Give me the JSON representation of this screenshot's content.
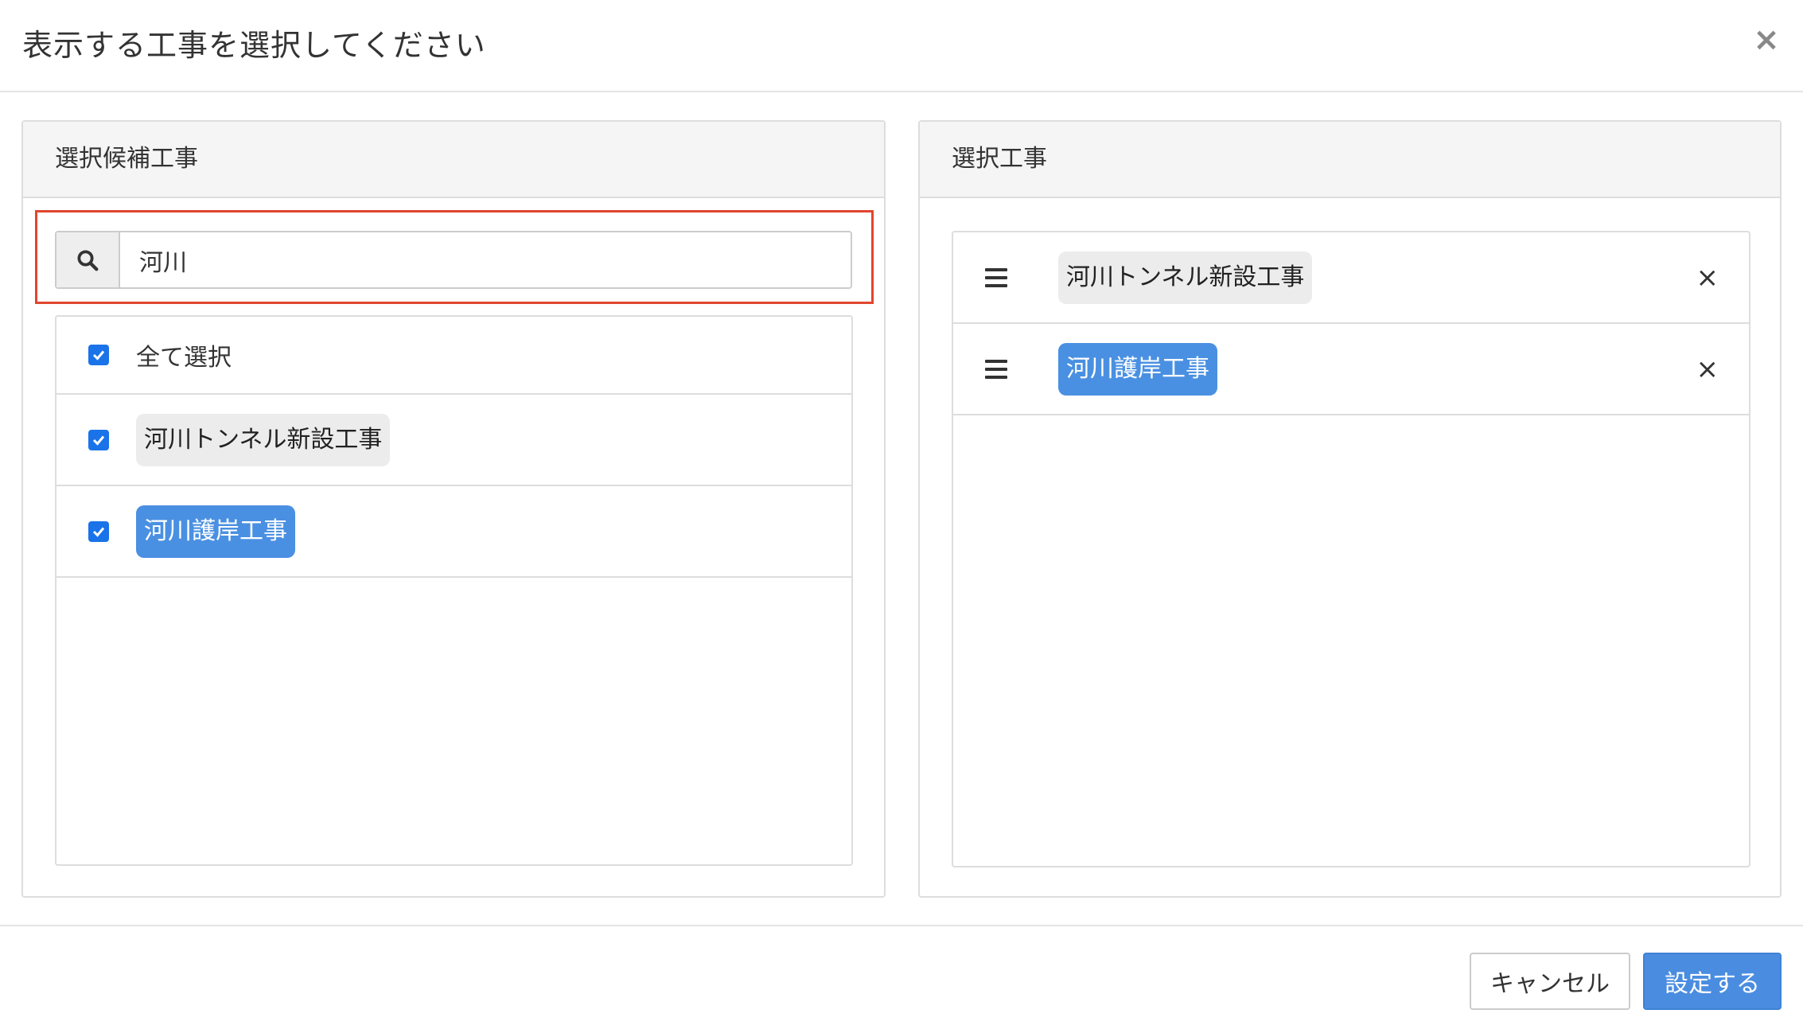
{
  "modal": {
    "title": "表示する工事を選択してください",
    "close_icon": "×"
  },
  "left_panel": {
    "heading": "選択候補工事",
    "search": {
      "icon": "search-icon",
      "value": "河川",
      "placeholder": ""
    },
    "select_all_label": "全て選択",
    "items": [
      {
        "label": "河川トンネル新設工事",
        "checked": true,
        "tag_color": "#ececec"
      },
      {
        "label": "河川護岸工事",
        "checked": true,
        "tag_color": "#4a90e2"
      }
    ]
  },
  "right_panel": {
    "heading": "選択工事",
    "items": [
      {
        "label": "河川トンネル新設工事",
        "tag_color": "#ececec",
        "drag_icon": "drag-handle-icon",
        "remove_icon": "×"
      },
      {
        "label": "河川護岸工事",
        "tag_color": "#4a90e2",
        "drag_icon": "drag-handle-icon",
        "remove_icon": "×"
      }
    ]
  },
  "footer": {
    "cancel_label": "キャンセル",
    "confirm_label": "設定する"
  },
  "colors": {
    "highlight": "#e0462e",
    "primary": "#4a8de0",
    "checkbox": "#1a73e8"
  }
}
